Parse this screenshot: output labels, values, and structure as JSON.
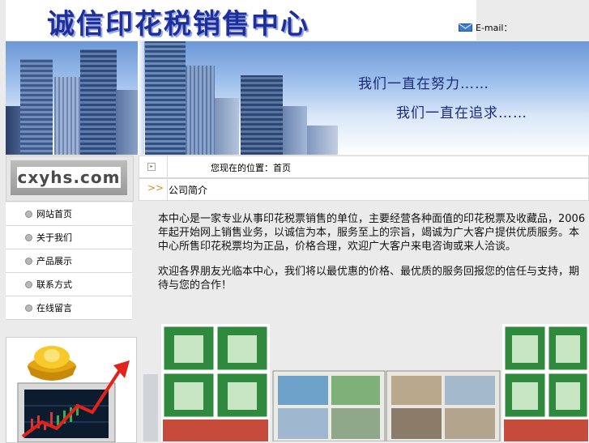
{
  "header": {
    "site_title": "诚信印花税销售中心",
    "email_label": "E-mail："
  },
  "banner": {
    "slogan_line1": "我们一直在努力……",
    "slogan_line2": "我们一直在追求……"
  },
  "logo": {
    "text": "cxyhs.com"
  },
  "sidebar": {
    "items": [
      {
        "label": "网站首页"
      },
      {
        "label": "关于我们"
      },
      {
        "label": "产品展示"
      },
      {
        "label": "联系方式"
      },
      {
        "label": "在线留言"
      }
    ]
  },
  "nav": {
    "location_text": "您现在的位置：首页",
    "section_marker": ">>",
    "section_title": "公司简介"
  },
  "content": {
    "paragraph1": "本中心是一家专业从事印花税票销售的单位，主要经营各种面值的印花税票及收藏品，2006年起开始网上销售业务，以诚信为本，服务至上的宗旨，竭诚为广大客户提供优质服务。本中心所售印花税票均为正品，价格合理，欢迎广大客户来电咨询或来人洽谈。",
    "paragraph2": "欢迎各界朋友光临本中心，我们将以最优惠的价格、最优质的服务回报您的信任与支持，期待与您的合作！"
  },
  "colors": {
    "title_blue": "#1d2f9a",
    "accent_orange": "#d88c28",
    "page_bg": "#ebebeb"
  }
}
